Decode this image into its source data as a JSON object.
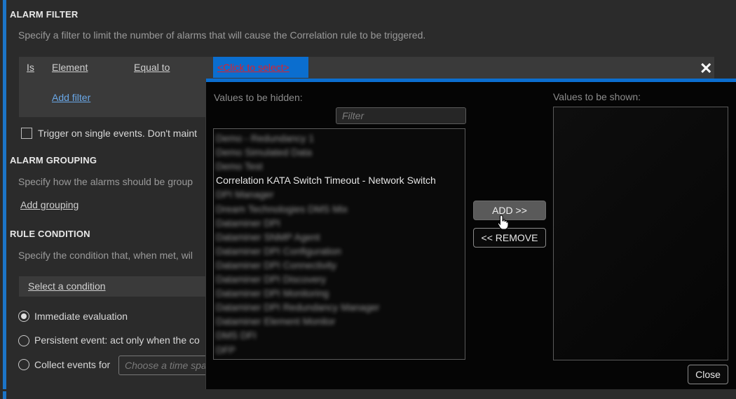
{
  "alarm_filter": {
    "title": "ALARM FILTER",
    "description": "Specify a filter to limit the number of alarms that will cause the Correlation rule to be triggered.",
    "headers": {
      "is": "Is",
      "element": "Element",
      "equal_to": "Equal to"
    },
    "click_to_select": "<Click to select>",
    "add_filter": "Add filter",
    "close_icon": "close-icon"
  },
  "trigger_label": "Trigger on single events. Don't maint",
  "alarm_grouping": {
    "title": "ALARM GROUPING",
    "description": "Specify how the alarms should be group",
    "add_grouping": "Add grouping"
  },
  "rule_condition": {
    "title": "RULE CONDITION",
    "description": "Specify the condition that, when met, wil",
    "select_condition": "Select a condition",
    "options": [
      {
        "label": "Immediate evaluation",
        "selected": true
      },
      {
        "label": "Persistent event: act only when the co",
        "selected": false
      },
      {
        "label": "Collect events for",
        "selected": false
      }
    ],
    "time_placeholder": "Choose a time spa"
  },
  "popup": {
    "hidden_label": "Values to be hidden:",
    "shown_label": "Values to be shown:",
    "filter_placeholder": "Filter",
    "hidden_items": [
      "Demo - Redundancy 1",
      "Demo Simulated Data",
      "Demo Test",
      "Correlation KATA Switch Timeout - Network Switch",
      "DPI Manager",
      "Dream Technologies DMS Mix",
      "Dataminer DPI",
      "Dataminer SNMP Agent",
      "Dataminer DPI Configuration",
      "Dataminer DPI Connectivity",
      "Dataminer DPI Discovery",
      "Dataminer DPI Monitoring",
      "Dataminer DPI Redundancy Manager",
      "Dataminer Element Monitor",
      "DMS DFI",
      "DFP"
    ],
    "selected_item_index": 3,
    "shown_items": [],
    "add_button": "ADD >>",
    "remove_button": "<< REMOVE",
    "close_button": "Close"
  },
  "colors": {
    "accent": "#0b6ecf",
    "link": "#6aa8e8",
    "click_select_text": "#e0202a"
  }
}
